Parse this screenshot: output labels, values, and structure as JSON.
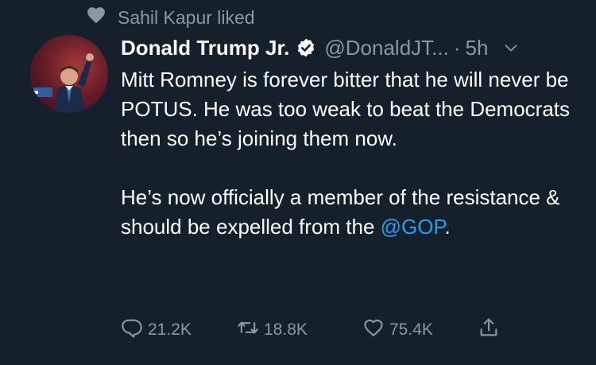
{
  "social_context": {
    "icon": "heart-icon",
    "text": "Sahil Kapur liked"
  },
  "tweet": {
    "author": {
      "display_name": "Donald Trump Jr.",
      "handle": "@DonaldJT...",
      "verified": true
    },
    "separator": "·",
    "time": "5h",
    "paragraph_1": "Mitt Romney is forever bitter that he will never be POTUS. He was too weak to beat the Democrats then so he’s joining them now.",
    "paragraph_2_text": "He’s now officially a member of the resistance & should be expelled from the ",
    "paragraph_2_mention": "@GOP",
    "paragraph_2_end": "."
  },
  "actions": {
    "replies": "21.2K",
    "retweets": "18.8K",
    "likes": "75.4K"
  },
  "colors": {
    "background": "#15202b",
    "secondary_text": "#8899a6",
    "link": "#1da1f2"
  }
}
